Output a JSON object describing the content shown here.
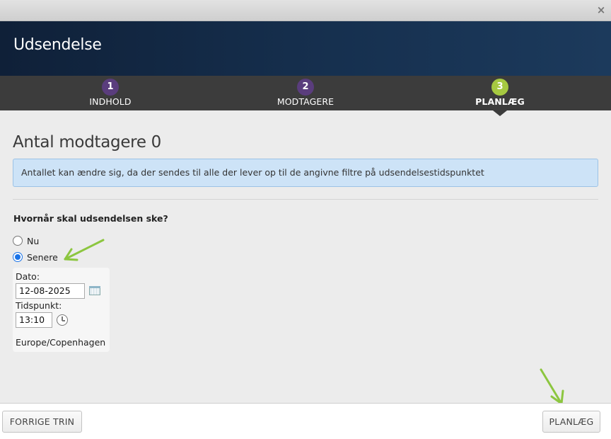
{
  "window": {
    "close_label": "×"
  },
  "header": {
    "title": "Udsendelse"
  },
  "steps": [
    {
      "number": "1",
      "label": "INDHOLD",
      "active": false
    },
    {
      "number": "2",
      "label": "MODTAGERE",
      "active": false
    },
    {
      "number": "3",
      "label": "PLANLÆG",
      "active": true
    }
  ],
  "main": {
    "title": "Antal modtagere 0",
    "info": "Antallet kan ændre sig, da der sendes til alle der lever op til de angivne filtre på udsendelsestidspunktet",
    "question": "Hvornår skal udsendelsen ske?",
    "options": [
      {
        "label": "Nu",
        "checked": false
      },
      {
        "label": "Senere",
        "checked": true
      }
    ],
    "schedule": {
      "date_label": "Dato:",
      "date_value": "12-08-2025",
      "time_label": "Tidspunkt:",
      "time_value": "13:10",
      "timezone": "Europe/Copenhagen"
    }
  },
  "footer": {
    "prev_label": "FORRIGE TRIN",
    "submit_label": "PLANLÆG"
  },
  "colors": {
    "header_bg": "#16304f",
    "steps_bg": "#3c3c3c",
    "step_inactive": "#5a3d7d",
    "step_active": "#a6c941",
    "info_bg": "#cde3f7",
    "annotation_arrow": "#8cc63f"
  },
  "icons": {
    "date_picker": "calendar-icon",
    "time_picker": "clock-icon",
    "close": "close-icon"
  }
}
